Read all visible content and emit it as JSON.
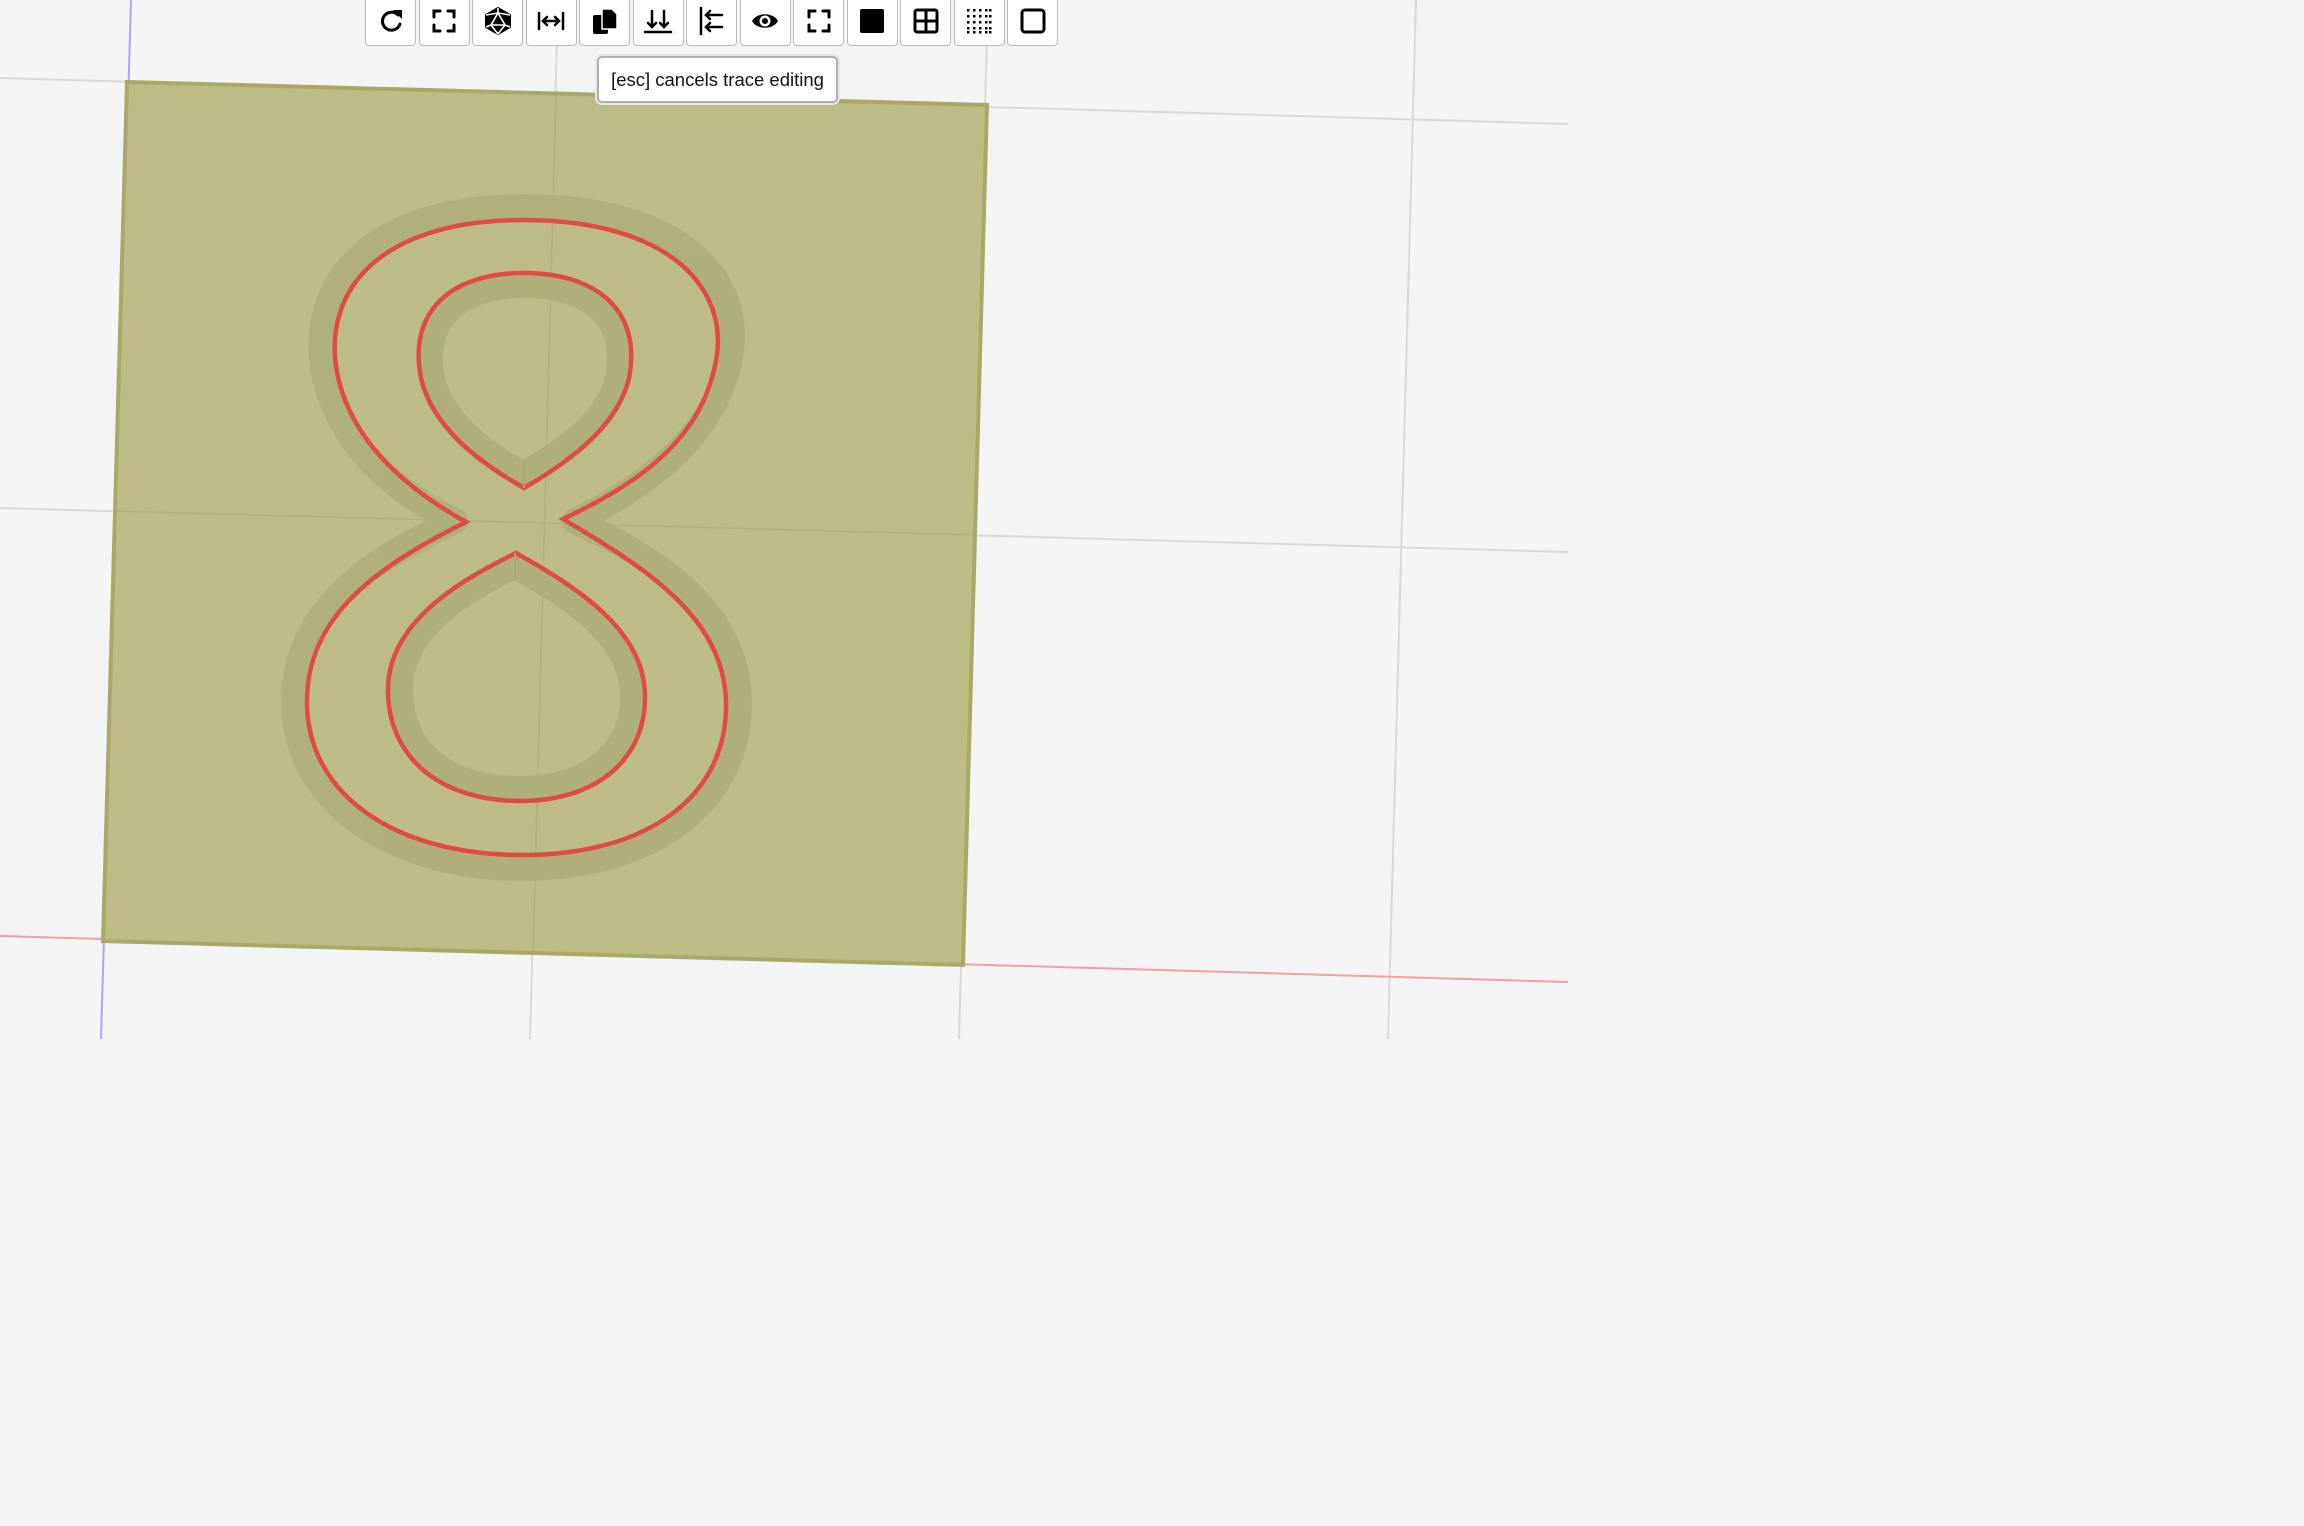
{
  "toolbar": {
    "buttons": [
      {
        "icon": "redo-icon",
        "name": "redo-button"
      },
      {
        "icon": "fit-view-icon",
        "name": "fit-view-button"
      },
      {
        "icon": "polyhedron-icon",
        "name": "3d-view-button"
      },
      {
        "icon": "measure-width-icon",
        "name": "measure-button"
      },
      {
        "icon": "copy-icon",
        "name": "copy-button"
      },
      {
        "icon": "align-bottom-icon",
        "name": "align-bottom-button"
      },
      {
        "icon": "align-left-icon",
        "name": "align-left-button"
      },
      {
        "icon": "eye-icon",
        "name": "visibility-button"
      },
      {
        "icon": "fullscreen-icon",
        "name": "fullscreen-button"
      },
      {
        "icon": "solid-square-icon",
        "name": "solid-view-button"
      },
      {
        "icon": "grid-icon",
        "name": "grid-button"
      },
      {
        "icon": "dotted-grid-icon",
        "name": "dot-grid-button"
      },
      {
        "icon": "outline-square-icon",
        "name": "wireframe-button"
      }
    ]
  },
  "tooltip": {
    "text": "[esc] cancels trace editing"
  },
  "canvas": {
    "glyph": "8",
    "colors": {
      "background": "#f4f4f4",
      "plate": "#bcbc84",
      "plate_edge": "#a9a967",
      "trace": "#e04b40",
      "engrave": "#afaf7a",
      "grid": "#d6d6d6",
      "axis_x": "#f2a8a8",
      "axis_y": "#a8a8f2"
    }
  }
}
